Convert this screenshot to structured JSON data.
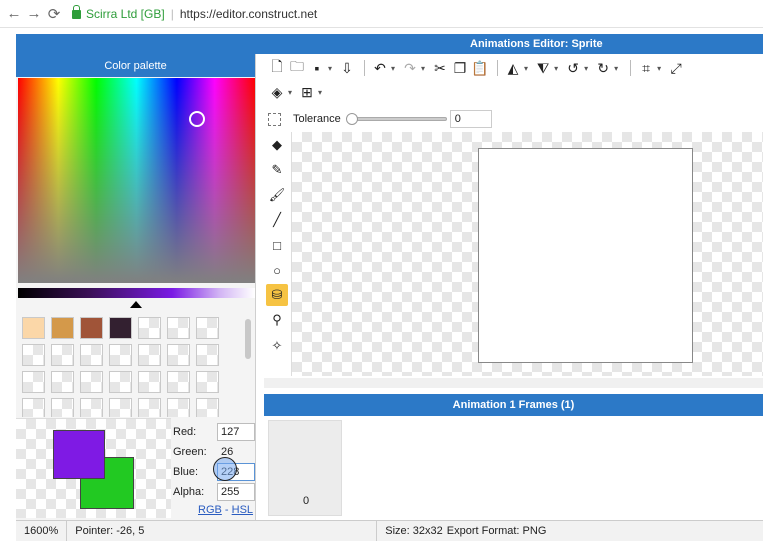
{
  "browser": {
    "back_icon": "←",
    "forward_icon": "→",
    "reload_icon": "⟳",
    "site_name": "Scirra Ltd [GB]",
    "separator": "|",
    "url": "https://editor.construct.net"
  },
  "editor": {
    "title": "Animations Editor: Sprite"
  },
  "palette": {
    "header": "Color palette",
    "swatch_colors": [
      "#fbd7a8",
      "#d4994a",
      "#a05438",
      "#332030"
    ],
    "labels": {
      "red": "Red:",
      "green": "Green:",
      "blue": "Blue:",
      "alpha": "Alpha:"
    },
    "values": {
      "red": "127",
      "green": "26",
      "blue": "228",
      "alpha": "255"
    },
    "primary_color": "#7f1ae4",
    "secondary_color": "#22c922",
    "mode_rgb": "RGB",
    "mode_sep": " - ",
    "mode_hsl": "HSL"
  },
  "toolbar": {
    "tolerance_label": "Tolerance",
    "tolerance_value": "0"
  },
  "frames": {
    "header": "Animation 1 Frames (1)",
    "frame_index": "0"
  },
  "status": {
    "zoom": "1600%",
    "pointer": "Pointer: -26, 5",
    "size": "Size: 32x32",
    "export_format": "Export Format: PNG"
  },
  "colors": {
    "accent": "#2c79c7",
    "active_tool": "#f6c343",
    "secure": "#2e9d3a"
  }
}
